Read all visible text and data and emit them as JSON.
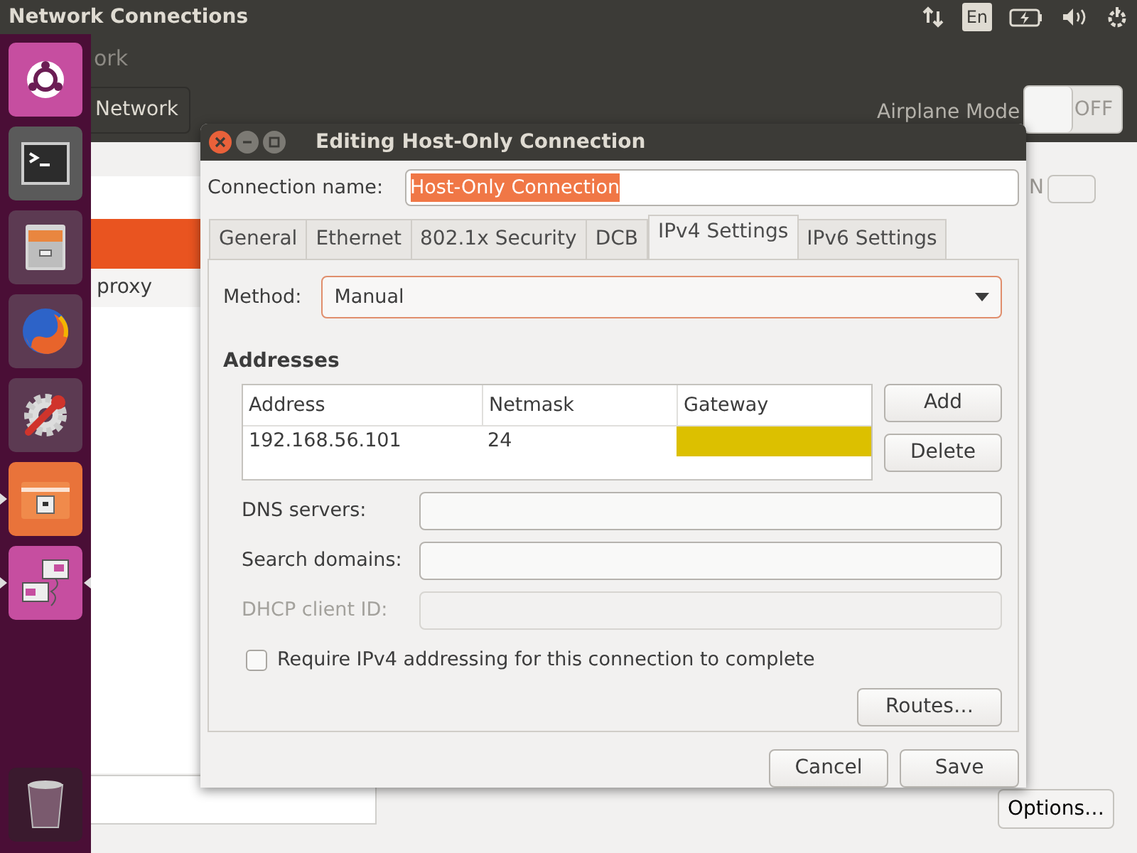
{
  "top_panel": {
    "title": "Network Connections",
    "keyboard_layout": "En"
  },
  "launcher": {
    "items": [
      {
        "kind": "ubuntu",
        "running": false,
        "focused": false
      },
      {
        "kind": "terminal",
        "running": false,
        "focused": false
      },
      {
        "kind": "files",
        "running": false,
        "focused": false
      },
      {
        "kind": "browser",
        "running": false,
        "focused": false
      },
      {
        "kind": "settings",
        "running": false,
        "focused": false
      },
      {
        "kind": "folder",
        "running": true,
        "focused": false
      },
      {
        "kind": "network",
        "running": true,
        "focused": true
      }
    ],
    "trash": {
      "kind": "trash"
    }
  },
  "background_window": {
    "title": "ork",
    "network_button": "Network",
    "airplane_mode": {
      "label": "Airplane Mode",
      "switch_text": "OFF",
      "on": false
    },
    "list": [
      {
        "selected": true
      },
      {
        "label": "proxy",
        "selected": false
      }
    ],
    "toggle_text": "N",
    "toggle_on": true,
    "options_button": "Options…"
  },
  "dialog": {
    "title": "Editing Host-Only Connection",
    "connection_name_label": "Connection name:",
    "connection_name": "Host-Only Connection",
    "connection_name_selected": true,
    "tabs": [
      {
        "label": "General",
        "selected": false
      },
      {
        "label": "Ethernet",
        "selected": false
      },
      {
        "label": "802.1x Security",
        "selected": false
      },
      {
        "label": "DCB",
        "selected": false
      },
      {
        "label": "IPv4 Settings",
        "selected": true
      },
      {
        "label": "IPv6 Settings",
        "selected": false
      }
    ],
    "method_label": "Method:",
    "method": "Manual",
    "addresses_heading": "Addresses",
    "table": {
      "columns": [
        "Address",
        "Netmask",
        "Gateway"
      ],
      "rows": [
        {
          "address": "192.168.56.101",
          "netmask": "24",
          "gateway_editing": true
        }
      ]
    },
    "table_buttons": [
      "Add",
      "Delete"
    ],
    "fields": [
      {
        "label": "DNS servers:",
        "disabled": false
      },
      {
        "label": "Search domains:",
        "disabled": false
      },
      {
        "label": "DHCP client ID:",
        "disabled": true
      }
    ],
    "require_checkbox": {
      "label": "Require IPv4 addressing for this connection to complete",
      "checked": false
    },
    "routes_button": "Routes…",
    "buttons": [
      "Cancel",
      "Save"
    ]
  }
}
